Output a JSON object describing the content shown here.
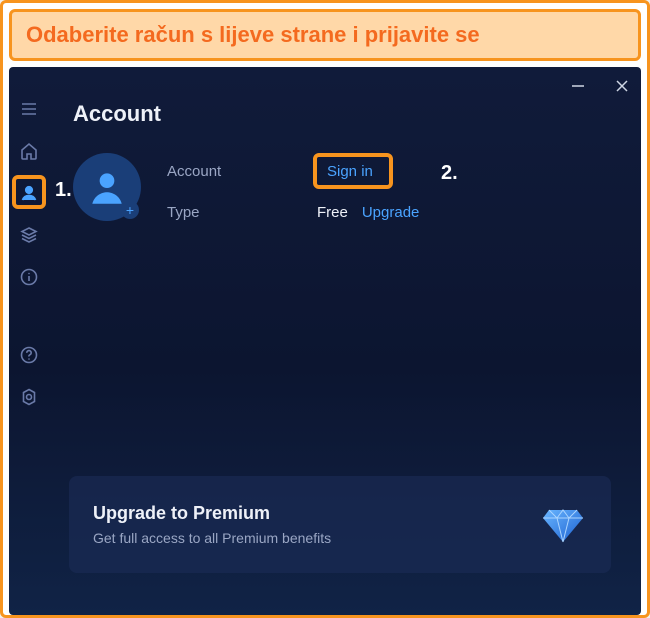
{
  "banner": {
    "text": "Odaberite račun s lijeve strane i prijavite se"
  },
  "annotations": {
    "one": "1.",
    "two": "2."
  },
  "page": {
    "title": "Account"
  },
  "account": {
    "label_account": "Account",
    "signin": "Sign in",
    "label_type": "Type",
    "type_value": "Free",
    "upgrade": "Upgrade"
  },
  "promo": {
    "title": "Upgrade to Premium",
    "subtitle": "Get full access to all Premium benefits"
  }
}
